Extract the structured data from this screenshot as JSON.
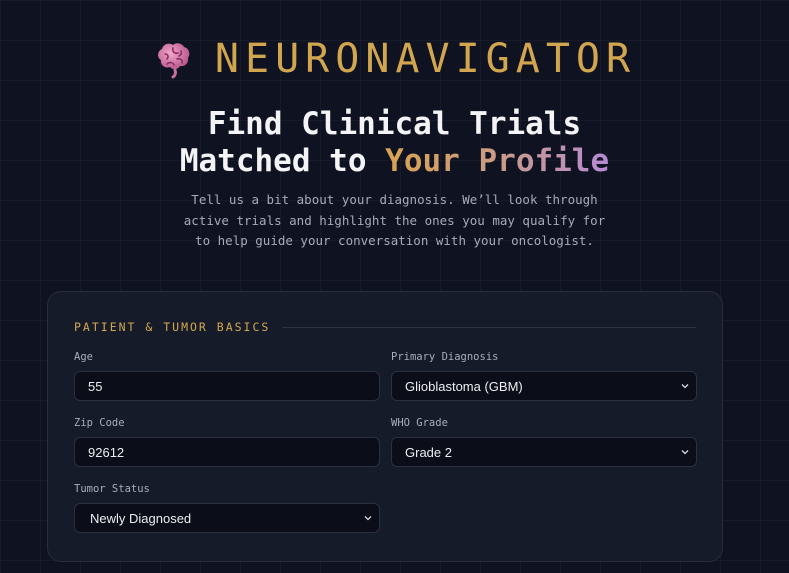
{
  "brand": {
    "name": "NEURONAVIGATOR",
    "icon": "brain-icon"
  },
  "headline": {
    "line1": "Find Clinical Trials",
    "line2_plain": "Matched to ",
    "line2_highlight": "Your Profile"
  },
  "subtitle": [
    "Tell us a bit about your diagnosis. We’ll look through",
    "active trials and highlight the ones you may qualify for",
    "to help guide your conversation with your oncologist."
  ],
  "section_title": "PATIENT & TUMOR BASICS",
  "fields": {
    "age": {
      "label": "Age",
      "value": "55"
    },
    "primary_diagnosis": {
      "label": "Primary Diagnosis",
      "value": "Glioblastoma (GBM)"
    },
    "zip_code": {
      "label": "Zip Code",
      "value": "92612"
    },
    "who_grade": {
      "label": "WHO Grade",
      "value": "Grade 2"
    },
    "tumor_status": {
      "label": "Tumor Status",
      "value": "Newly Diagnosed"
    }
  },
  "colors": {
    "background": "#0f1220",
    "card": "#161b2a",
    "accent_gold": "#d2a64f",
    "accent_purple": "#b78ad6"
  }
}
